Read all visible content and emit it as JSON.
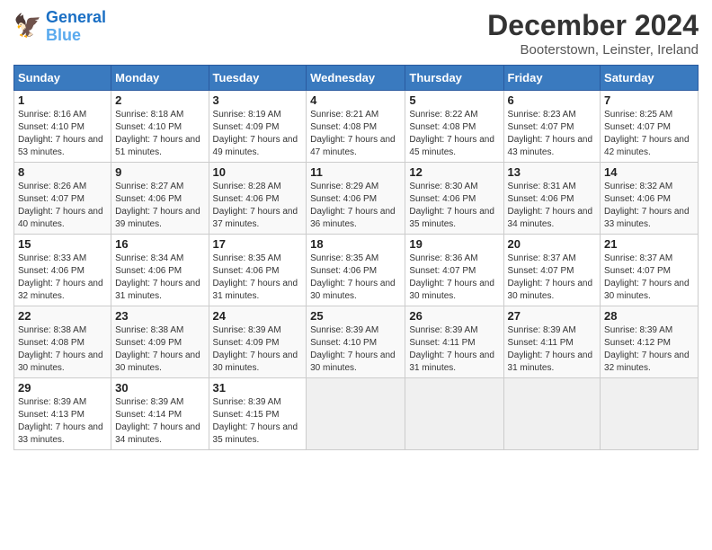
{
  "header": {
    "logo_line1": "General",
    "logo_line2": "Blue",
    "month_title": "December 2024",
    "location": "Booterstown, Leinster, Ireland"
  },
  "days_of_week": [
    "Sunday",
    "Monday",
    "Tuesday",
    "Wednesday",
    "Thursday",
    "Friday",
    "Saturday"
  ],
  "weeks": [
    [
      {
        "day": "1",
        "sunrise": "Sunrise: 8:16 AM",
        "sunset": "Sunset: 4:10 PM",
        "daylight": "Daylight: 7 hours and 53 minutes."
      },
      {
        "day": "2",
        "sunrise": "Sunrise: 8:18 AM",
        "sunset": "Sunset: 4:10 PM",
        "daylight": "Daylight: 7 hours and 51 minutes."
      },
      {
        "day": "3",
        "sunrise": "Sunrise: 8:19 AM",
        "sunset": "Sunset: 4:09 PM",
        "daylight": "Daylight: 7 hours and 49 minutes."
      },
      {
        "day": "4",
        "sunrise": "Sunrise: 8:21 AM",
        "sunset": "Sunset: 4:08 PM",
        "daylight": "Daylight: 7 hours and 47 minutes."
      },
      {
        "day": "5",
        "sunrise": "Sunrise: 8:22 AM",
        "sunset": "Sunset: 4:08 PM",
        "daylight": "Daylight: 7 hours and 45 minutes."
      },
      {
        "day": "6",
        "sunrise": "Sunrise: 8:23 AM",
        "sunset": "Sunset: 4:07 PM",
        "daylight": "Daylight: 7 hours and 43 minutes."
      },
      {
        "day": "7",
        "sunrise": "Sunrise: 8:25 AM",
        "sunset": "Sunset: 4:07 PM",
        "daylight": "Daylight: 7 hours and 42 minutes."
      }
    ],
    [
      {
        "day": "8",
        "sunrise": "Sunrise: 8:26 AM",
        "sunset": "Sunset: 4:07 PM",
        "daylight": "Daylight: 7 hours and 40 minutes."
      },
      {
        "day": "9",
        "sunrise": "Sunrise: 8:27 AM",
        "sunset": "Sunset: 4:06 PM",
        "daylight": "Daylight: 7 hours and 39 minutes."
      },
      {
        "day": "10",
        "sunrise": "Sunrise: 8:28 AM",
        "sunset": "Sunset: 4:06 PM",
        "daylight": "Daylight: 7 hours and 37 minutes."
      },
      {
        "day": "11",
        "sunrise": "Sunrise: 8:29 AM",
        "sunset": "Sunset: 4:06 PM",
        "daylight": "Daylight: 7 hours and 36 minutes."
      },
      {
        "day": "12",
        "sunrise": "Sunrise: 8:30 AM",
        "sunset": "Sunset: 4:06 PM",
        "daylight": "Daylight: 7 hours and 35 minutes."
      },
      {
        "day": "13",
        "sunrise": "Sunrise: 8:31 AM",
        "sunset": "Sunset: 4:06 PM",
        "daylight": "Daylight: 7 hours and 34 minutes."
      },
      {
        "day": "14",
        "sunrise": "Sunrise: 8:32 AM",
        "sunset": "Sunset: 4:06 PM",
        "daylight": "Daylight: 7 hours and 33 minutes."
      }
    ],
    [
      {
        "day": "15",
        "sunrise": "Sunrise: 8:33 AM",
        "sunset": "Sunset: 4:06 PM",
        "daylight": "Daylight: 7 hours and 32 minutes."
      },
      {
        "day": "16",
        "sunrise": "Sunrise: 8:34 AM",
        "sunset": "Sunset: 4:06 PM",
        "daylight": "Daylight: 7 hours and 31 minutes."
      },
      {
        "day": "17",
        "sunrise": "Sunrise: 8:35 AM",
        "sunset": "Sunset: 4:06 PM",
        "daylight": "Daylight: 7 hours and 31 minutes."
      },
      {
        "day": "18",
        "sunrise": "Sunrise: 8:35 AM",
        "sunset": "Sunset: 4:06 PM",
        "daylight": "Daylight: 7 hours and 30 minutes."
      },
      {
        "day": "19",
        "sunrise": "Sunrise: 8:36 AM",
        "sunset": "Sunset: 4:07 PM",
        "daylight": "Daylight: 7 hours and 30 minutes."
      },
      {
        "day": "20",
        "sunrise": "Sunrise: 8:37 AM",
        "sunset": "Sunset: 4:07 PM",
        "daylight": "Daylight: 7 hours and 30 minutes."
      },
      {
        "day": "21",
        "sunrise": "Sunrise: 8:37 AM",
        "sunset": "Sunset: 4:07 PM",
        "daylight": "Daylight: 7 hours and 30 minutes."
      }
    ],
    [
      {
        "day": "22",
        "sunrise": "Sunrise: 8:38 AM",
        "sunset": "Sunset: 4:08 PM",
        "daylight": "Daylight: 7 hours and 30 minutes."
      },
      {
        "day": "23",
        "sunrise": "Sunrise: 8:38 AM",
        "sunset": "Sunset: 4:09 PM",
        "daylight": "Daylight: 7 hours and 30 minutes."
      },
      {
        "day": "24",
        "sunrise": "Sunrise: 8:39 AM",
        "sunset": "Sunset: 4:09 PM",
        "daylight": "Daylight: 7 hours and 30 minutes."
      },
      {
        "day": "25",
        "sunrise": "Sunrise: 8:39 AM",
        "sunset": "Sunset: 4:10 PM",
        "daylight": "Daylight: 7 hours and 30 minutes."
      },
      {
        "day": "26",
        "sunrise": "Sunrise: 8:39 AM",
        "sunset": "Sunset: 4:11 PM",
        "daylight": "Daylight: 7 hours and 31 minutes."
      },
      {
        "day": "27",
        "sunrise": "Sunrise: 8:39 AM",
        "sunset": "Sunset: 4:11 PM",
        "daylight": "Daylight: 7 hours and 31 minutes."
      },
      {
        "day": "28",
        "sunrise": "Sunrise: 8:39 AM",
        "sunset": "Sunset: 4:12 PM",
        "daylight": "Daylight: 7 hours and 32 minutes."
      }
    ],
    [
      {
        "day": "29",
        "sunrise": "Sunrise: 8:39 AM",
        "sunset": "Sunset: 4:13 PM",
        "daylight": "Daylight: 7 hours and 33 minutes."
      },
      {
        "day": "30",
        "sunrise": "Sunrise: 8:39 AM",
        "sunset": "Sunset: 4:14 PM",
        "daylight": "Daylight: 7 hours and 34 minutes."
      },
      {
        "day": "31",
        "sunrise": "Sunrise: 8:39 AM",
        "sunset": "Sunset: 4:15 PM",
        "daylight": "Daylight: 7 hours and 35 minutes."
      },
      null,
      null,
      null,
      null
    ]
  ]
}
